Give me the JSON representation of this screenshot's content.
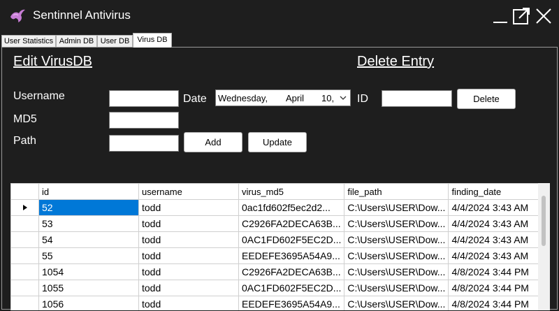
{
  "window": {
    "title": "Sentinnel Antivirus"
  },
  "tabs": [
    {
      "label": "User Statistics"
    },
    {
      "label": "Admin DB"
    },
    {
      "label": "User DB"
    },
    {
      "label": "Virus DB"
    }
  ],
  "edit": {
    "heading": "Edit VirusDB",
    "username_label": "Username",
    "md5_label": "MD5",
    "path_label": "Path",
    "date_label": "Date",
    "date_value": {
      "day": "Wednesday,",
      "month": "April",
      "date": "10,"
    },
    "add_label": "Add",
    "update_label": "Update",
    "username_value": "",
    "md5_value": "",
    "path_value": ""
  },
  "delete": {
    "heading": "Delete Entry",
    "id_label": "ID",
    "id_value": "",
    "delete_label": "Delete"
  },
  "grid": {
    "columns": [
      "id",
      "username",
      "virus_md5",
      "file_path",
      "finding_date"
    ],
    "rows": [
      {
        "id": "52",
        "username": "todd",
        "virus_md5": "0ac1fd602f5ec2d2...",
        "file_path": "C:\\Users\\USER\\Dow...",
        "finding_date": "4/4/2024 3:43 AM"
      },
      {
        "id": "53",
        "username": "todd",
        "virus_md5": "C2926FA2DECA63B...",
        "file_path": "C:\\Users\\USER\\Dow...",
        "finding_date": "4/4/2024 3:43 AM"
      },
      {
        "id": "54",
        "username": "todd",
        "virus_md5": "0AC1FD602F5EC2D...",
        "file_path": "C:\\Users\\USER\\Dow...",
        "finding_date": "4/4/2024 3:43 AM"
      },
      {
        "id": "55",
        "username": "todd",
        "virus_md5": "EEDEFE3695A54A9...",
        "file_path": "C:\\Users\\USER\\Dow...",
        "finding_date": "4/4/2024 3:43 AM"
      },
      {
        "id": "1054",
        "username": "todd",
        "virus_md5": "C2926FA2DECA63B...",
        "file_path": "C:\\Users\\USER\\Dow...",
        "finding_date": "4/8/2024 3:44 PM"
      },
      {
        "id": "1055",
        "username": "todd",
        "virus_md5": "0AC1FD602F5EC2D...",
        "file_path": "C:\\Users\\USER\\Dow...",
        "finding_date": "4/8/2024 3:44 PM"
      },
      {
        "id": "1056",
        "username": "todd",
        "virus_md5": "EEDEFE3695A54A9...",
        "file_path": "C:\\Users\\USER\\Dow...",
        "finding_date": "4/8/2024 3:44 PM"
      }
    ]
  },
  "icons": {
    "logo": "bird-logo-icon",
    "minimize": "minimize-icon",
    "maximize": "popout-icon",
    "close": "close-icon",
    "row_indicator": "row-pointer-icon",
    "dropdown": "chevron-down-icon"
  },
  "colors": {
    "background": "#1e1e1e",
    "selection": "#0078d7",
    "logo": "#c77dd6"
  }
}
